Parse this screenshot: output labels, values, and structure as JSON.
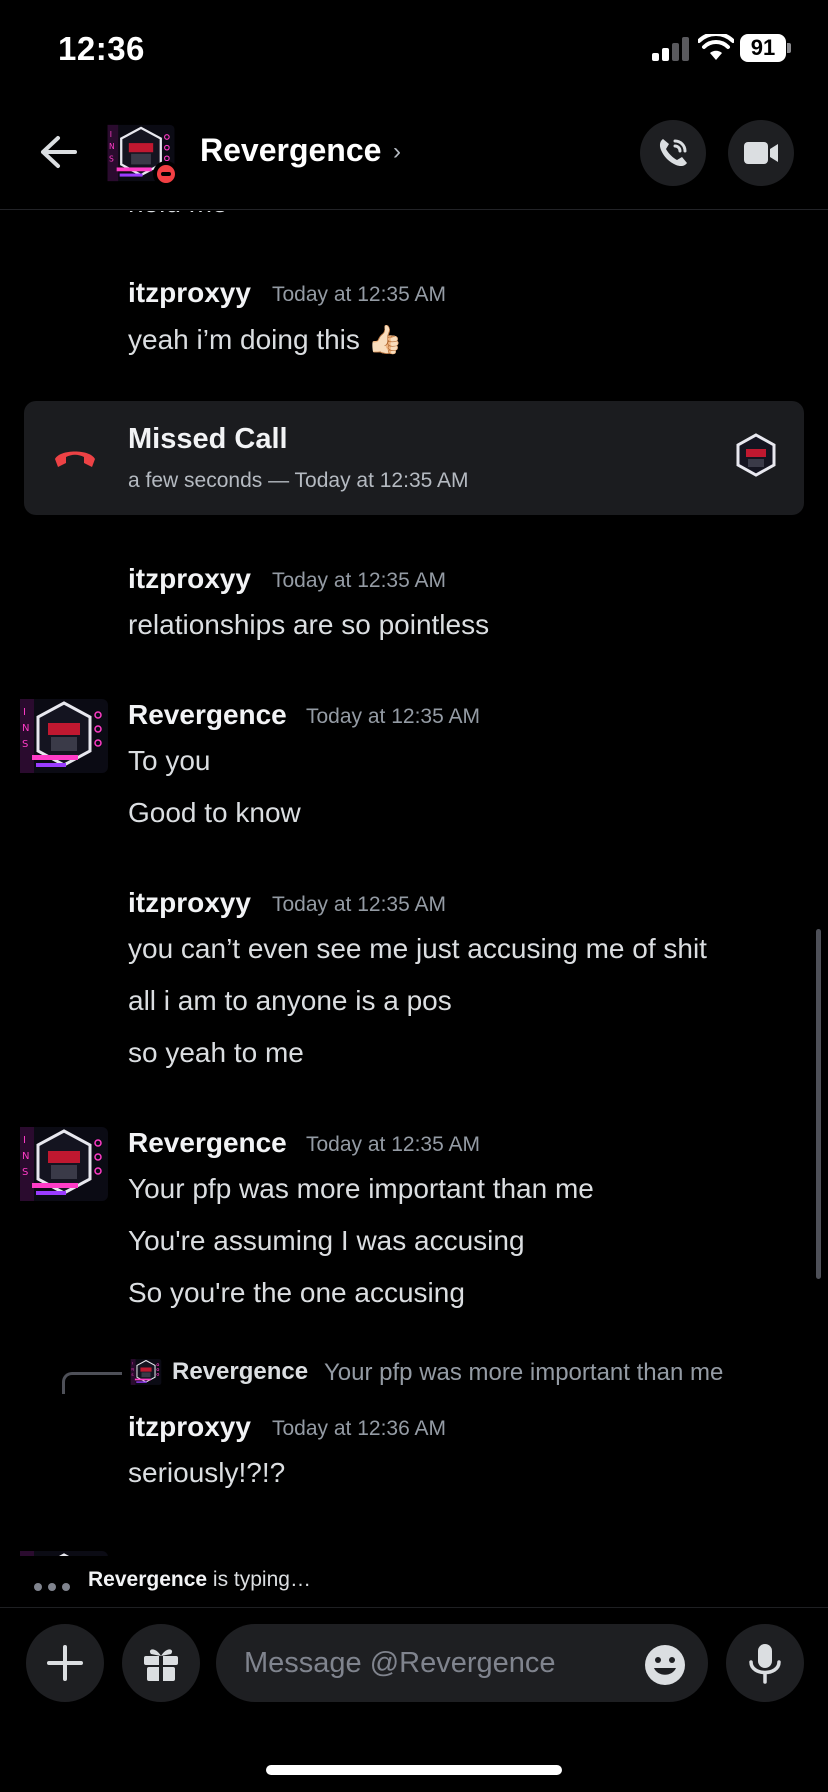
{
  "status_bar": {
    "time": "12:36",
    "battery": "91"
  },
  "header": {
    "title": "Revergence",
    "chevron": "›"
  },
  "messages": {
    "partial_top_text": "hold me",
    "m1": {
      "author": "itzproxyy",
      "time": "Today at 12:35 AM",
      "lines": [
        "yeah i’m doing this 👍🏻"
      ]
    },
    "missed_call": {
      "title": "Missed Call",
      "subtitle": "a few seconds — Today at 12:35 AM"
    },
    "m2": {
      "author": "itzproxyy",
      "time": "Today at 12:35 AM",
      "lines": [
        "relationships are so pointless"
      ]
    },
    "m3": {
      "author": "Revergence",
      "time": "Today at 12:35 AM",
      "lines": [
        "To you",
        "Good to know"
      ]
    },
    "m4": {
      "author": "itzproxyy",
      "time": "Today at 12:35 AM",
      "lines": [
        "you can’t even see me just accusing me of shit",
        "all i am to anyone is a pos",
        "so yeah to me"
      ]
    },
    "m5": {
      "author": "Revergence",
      "time": "Today at 12:35 AM",
      "lines": [
        "Your pfp was more important than me",
        "You're assuming I was accusing",
        "So you're the one accusing"
      ]
    },
    "reply": {
      "author": "Revergence",
      "text": "Your pfp was more important than me"
    },
    "m6": {
      "author": "itzproxyy",
      "time": "Today at 12:36 AM",
      "lines": [
        "seriously!?!?"
      ]
    }
  },
  "typing": {
    "name": "Revergence",
    "suffix": " is typing…"
  },
  "composer": {
    "placeholder": "Message @Revergence"
  },
  "icons": {
    "back": "arrow-left-icon",
    "call": "phone-icon",
    "video": "video-camera-icon",
    "missed_call": "phone-hangup-icon",
    "plus": "plus-icon",
    "gift": "gift-icon",
    "emoji": "emoji-icon",
    "mic": "microphone-icon"
  },
  "colors": {
    "background": "#000000",
    "missed_call_red": "#ed4245",
    "dnd_red": "#f23f43",
    "avatar_accent": "#ff3cc7"
  }
}
